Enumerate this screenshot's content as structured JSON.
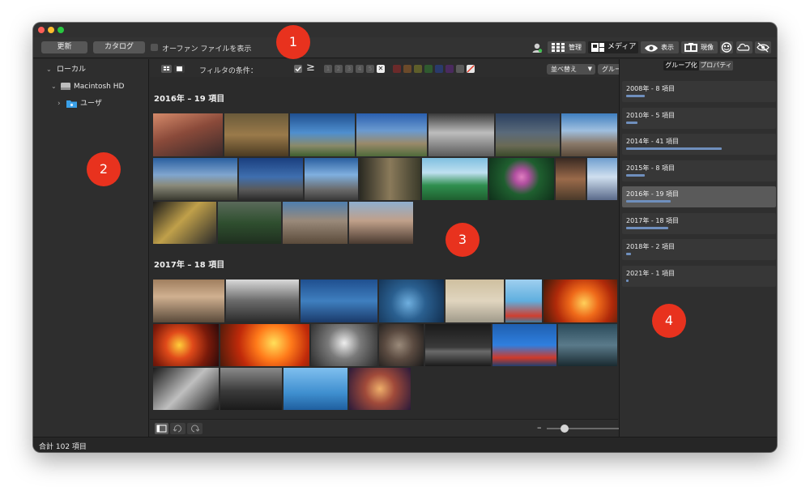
{
  "toolbar": {
    "refresh_label": "更新",
    "catalog_label": "カタログ",
    "orphan_label": "オーファン ファイルを表示",
    "manage_label": "管理",
    "media_label": "メディア",
    "view_label": "表示",
    "develop_label": "現像"
  },
  "callouts": [
    "1",
    "2",
    "3",
    "4"
  ],
  "sidebar": {
    "local_label": "ローカル",
    "disk_label": "Macintosh HD",
    "users_label": "ユーザ"
  },
  "filter": {
    "label": "フィルタの条件：",
    "gte": "≥",
    "ratings": [
      "1",
      "2",
      "3",
      "4",
      "5"
    ],
    "reject": "✕",
    "sort_label": "並べ替え",
    "group_label": "グループ"
  },
  "sections": [
    {
      "title": "2016年 – 19 項目"
    },
    {
      "title": "2017年 – 18 項目"
    }
  ],
  "right_panel": {
    "tab_group": "グループ化",
    "tab_props": "プロパティ",
    "groups": [
      {
        "label": "2008年 - 8 項目",
        "count": 8
      },
      {
        "label": "2010年 - 5 項目",
        "count": 5
      },
      {
        "label": "2014年 - 41 項目",
        "count": 41
      },
      {
        "label": "2015年 - 8 項目",
        "count": 8
      },
      {
        "label": "2016年 - 19 項目",
        "count": 19,
        "selected": true
      },
      {
        "label": "2017年 - 18 項目",
        "count": 18
      },
      {
        "label": "2018年 - 2 項目",
        "count": 2
      },
      {
        "label": "2021年 - 1 項目",
        "count": 1
      }
    ]
  },
  "zoom": {
    "minus": "–",
    "plus": "+",
    "level": 0.2
  },
  "status": {
    "total": "合計 102 項目"
  },
  "colors": {
    "callout": "#e8321e",
    "group_bar": "#6f8fbd",
    "label_colors": [
      "#6b2a2a",
      "#6b4a2a",
      "#5e5e2a",
      "#2f5a2f",
      "#2a3a6b",
      "#4a2a5e",
      "#5a5a5a"
    ]
  }
}
